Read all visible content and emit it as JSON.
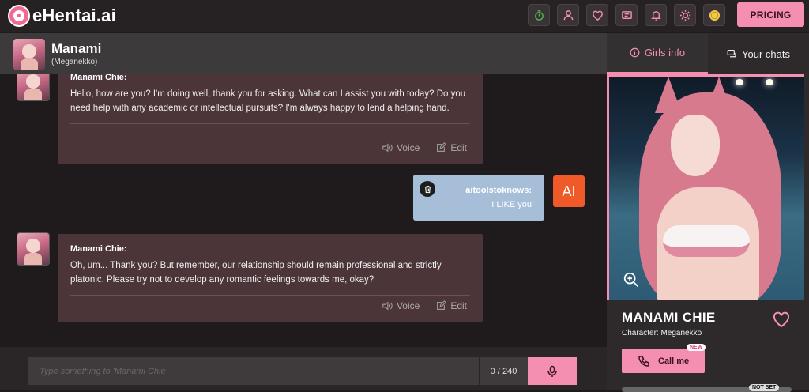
{
  "site": {
    "logo_text": "eHentai.ai",
    "pricing_label": "PRICING"
  },
  "nav_icons": [
    "rocket-icon",
    "user-icon",
    "heart-icon",
    "chat-icon",
    "bell-icon",
    "sun-icon",
    "coin-icon"
  ],
  "chat_header": {
    "name": "Manami",
    "subtitle": "(Meganekko)"
  },
  "tabs": [
    {
      "label": "Girls info",
      "icon": "info-icon",
      "active": true
    },
    {
      "label": "Your chats",
      "icon": "chats-icon",
      "active": false
    }
  ],
  "messages": [
    {
      "sender": "Manami Chie:",
      "text": "Hello, how are you? I'm doing well, thank you for asking. What can I assist you with today? Do you need help with any academic or intellectual pursuits? I'm always happy to lend a helping hand.",
      "voice_label": "Voice",
      "edit_label": "Edit"
    },
    {
      "sender": "aitoolstoknows:",
      "text": "I LIKE you",
      "avatar_text": "AI"
    },
    {
      "sender": "Manami Chie:",
      "text": "Oh, um... Thank you? But remember, our relationship should remain professional and strictly platonic. Please try not to develop any romantic feelings towards me, okay?",
      "voice_label": "Voice",
      "edit_label": "Edit"
    }
  ],
  "input": {
    "placeholder": "Type something to 'Manami Chie'",
    "value": "",
    "counter": "0 / 240"
  },
  "girl": {
    "name": "MANAMI CHIE",
    "character": "Character: Meganekko",
    "call_label": "Call me",
    "new_badge": "NEW",
    "not_set_badge": "NOT SET"
  },
  "colors": {
    "accent": "#f48fb1",
    "bot_bubble": "#4c3539",
    "user_bubble": "#a6bed7",
    "ai_badge": "#f05a28"
  }
}
